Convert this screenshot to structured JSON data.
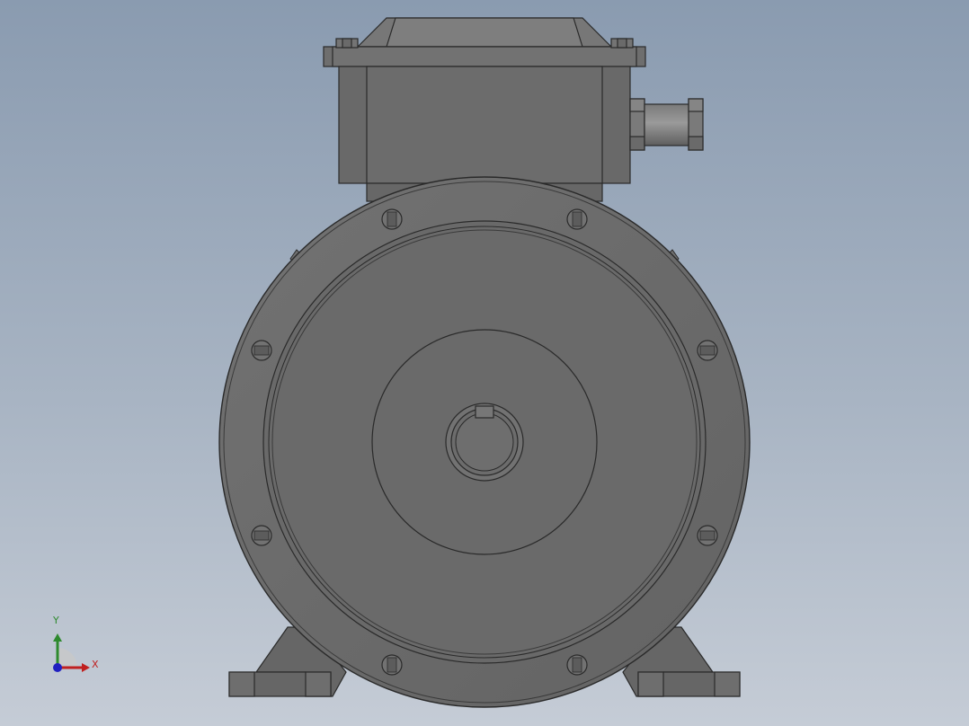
{
  "scene": {
    "model": "electric-motor-front-view",
    "view_background": [
      "#8a9bb0",
      "#c5ccd6"
    ],
    "body_color": "#6b6b6b",
    "edge_color": "#2a2a2a"
  },
  "triad": {
    "y_label": "Y",
    "x_label": "X",
    "y_color": "#2e8a2e",
    "x_color": "#c02020",
    "z_color": "#2020c0"
  }
}
